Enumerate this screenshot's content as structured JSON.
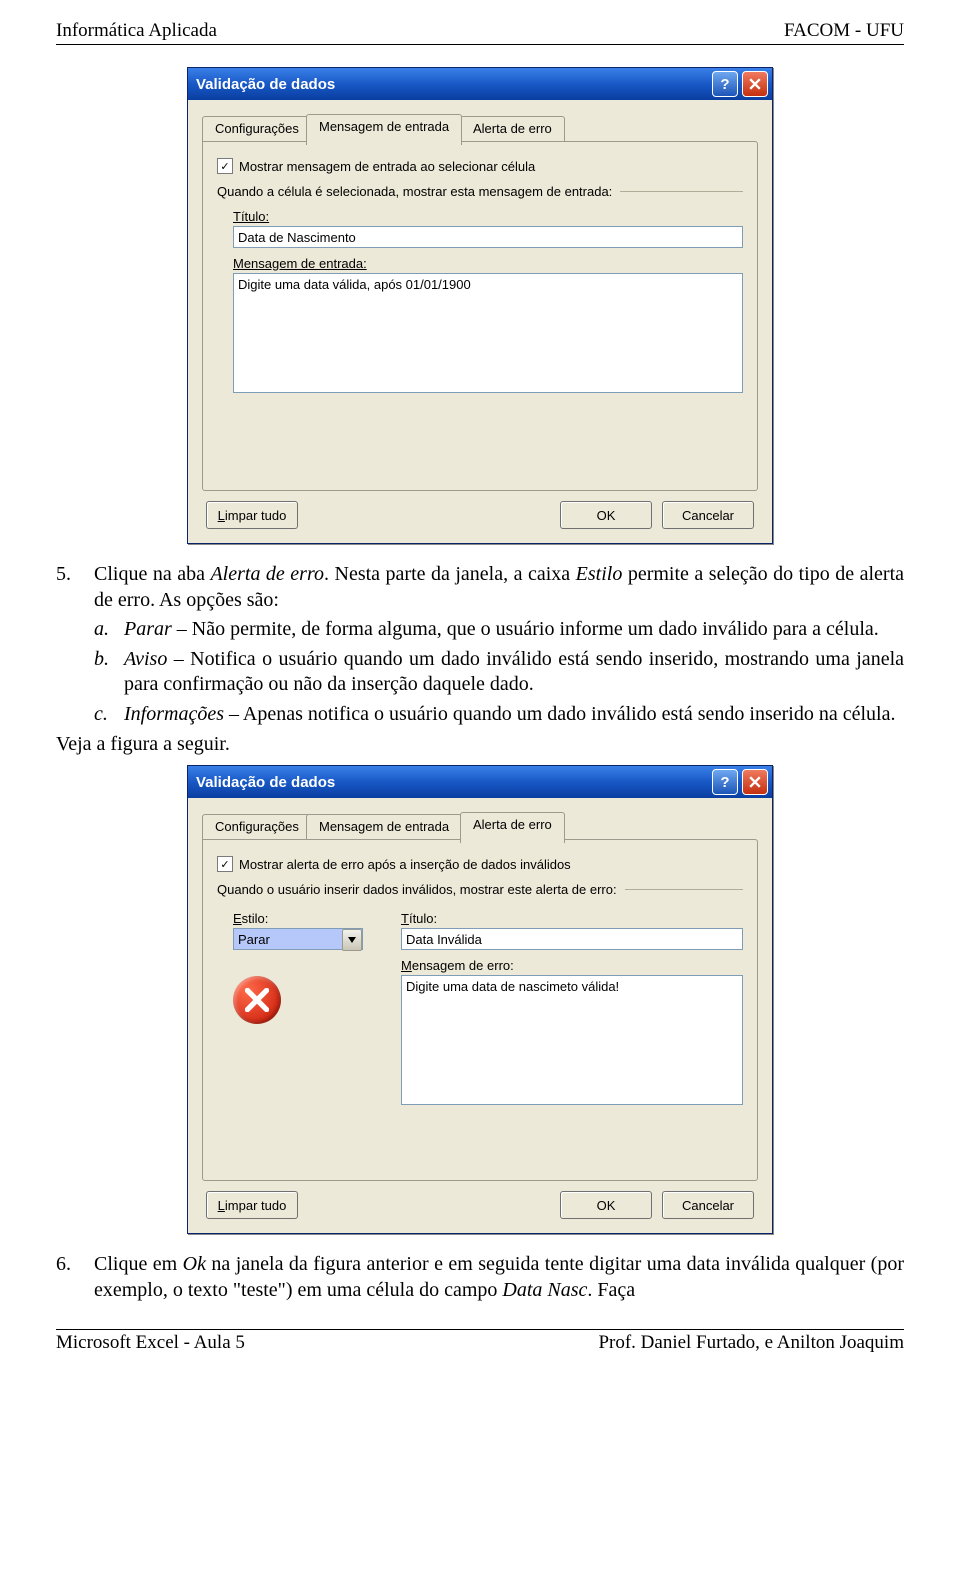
{
  "header": {
    "left": "Informática Aplicada",
    "right": "FACOM - UFU"
  },
  "footer": {
    "left": "Microsoft Excel - Aula 5",
    "right": "Prof. Daniel Furtado, e Anilton Joaquim"
  },
  "dialog1": {
    "title": "Validação de dados",
    "tabs": {
      "t1": "Configurações",
      "t2": "Mensagem de entrada",
      "t3": "Alerta de erro"
    },
    "checkbox_label": "Mostrar mensagem de entrada ao selecionar célula",
    "group_label": "Quando a célula é selecionada, mostrar esta mensagem de entrada:",
    "titulo_label": "Título:",
    "titulo_value": "Data de Nascimento",
    "msg_label": "Mensagem de entrada:",
    "msg_value": "Digite uma data válida, após 01/01/1900",
    "btn_clear": "Limpar tudo",
    "btn_ok": "OK",
    "btn_cancel": "Cancelar"
  },
  "step5": {
    "num": "5.",
    "text_a": "Clique na aba ",
    "text_b": "Alerta de erro",
    "text_c": ". Nesta parte da janela, a caixa ",
    "text_d": "Estilo",
    "text_e": " permite a seleção do tipo de alerta de erro. As opções são:",
    "a_n": "a.",
    "a_t1": "Parar",
    "a_t2": " – Não permite, de forma alguma, que o usuário informe um dado inválido para a célula.",
    "b_n": "b.",
    "b_t1": "Aviso",
    "b_t2": " – Notifica o usuário quando um dado inválido está sendo inserido, mostrando uma janela para confirmação ou não da inserção daquele dado.",
    "c_n": "c.",
    "c_t1": "Informações",
    "c_t2": " – Apenas notifica o usuário quando um dado inválido está sendo inserido na célula.",
    "follow": "Veja a figura a seguir."
  },
  "dialog2": {
    "title": "Validação de dados",
    "tabs": {
      "t1": "Configurações",
      "t2": "Mensagem de entrada",
      "t3": "Alerta de erro"
    },
    "checkbox_label": "Mostrar alerta de erro após a inserção de dados inválidos",
    "group_label": "Quando o usuário inserir dados inválidos, mostrar este alerta de erro:",
    "estilo_label": "Estilo:",
    "estilo_value": "Parar",
    "titulo_label": "Título:",
    "titulo_value": "Data Inválida",
    "msg_label": "Mensagem de erro:",
    "msg_value": "Digite uma data de nascimeto válida!",
    "btn_clear": "Limpar tudo",
    "btn_ok": "OK",
    "btn_cancel": "Cancelar"
  },
  "step6": {
    "num": "6.",
    "text_a": "Clique em ",
    "text_b": "Ok",
    "text_c": " na janela da figura anterior e em seguida tente digitar uma data inválida qualquer (por exemplo, o texto \"teste\") em uma célula do campo ",
    "text_d": "Data Nasc",
    "text_e": ". Faça"
  }
}
